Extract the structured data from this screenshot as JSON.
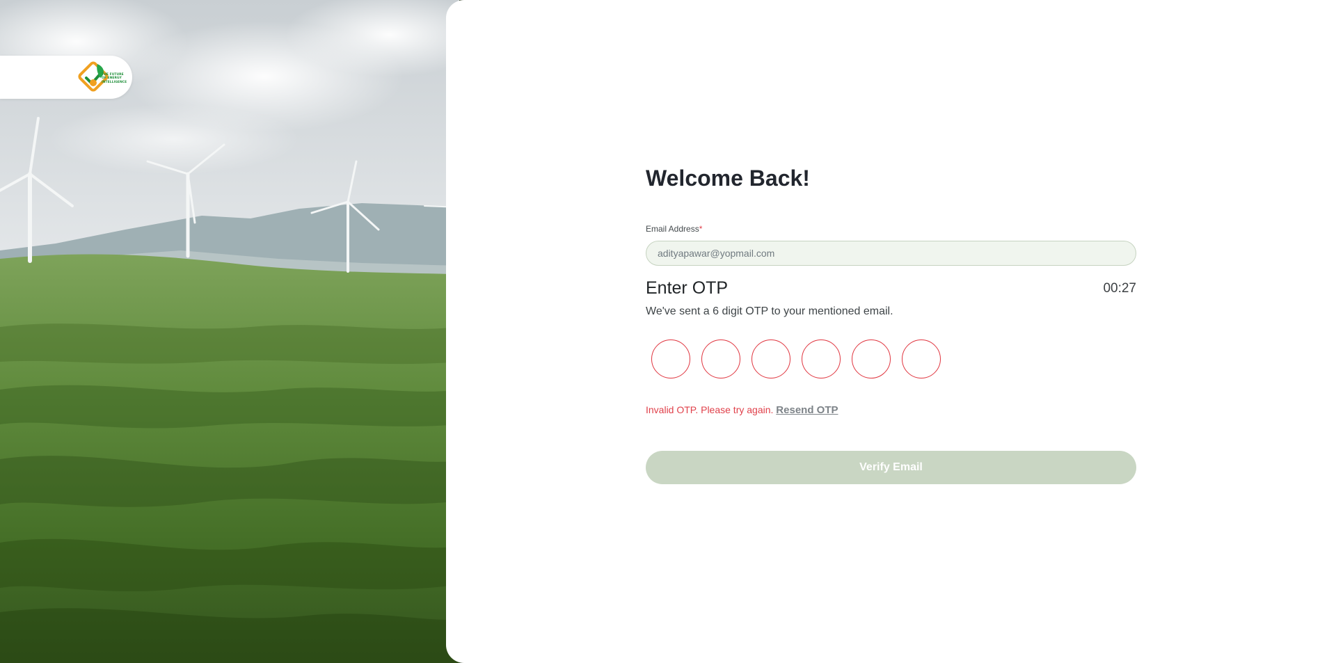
{
  "brand": {
    "logo_name": "leaf-checkmark-logo",
    "logo_lines": [
      "THE FUTURE",
      "OF ENERGY",
      "INTELLIGENCE"
    ]
  },
  "login": {
    "title": "Welcome Back!",
    "email": {
      "label": "Email Address",
      "required_marker": "*",
      "value": "adityapawar@yopmail.com"
    },
    "otp": {
      "title": "Enter OTP",
      "timer": "00:27",
      "description": "We've sent a 6 digit OTP to your mentioned email.",
      "digits": [
        "",
        "",
        "",
        "",
        "",
        ""
      ],
      "error_text": "Invalid OTP. Please try again.",
      "resend_label": "Resend OTP"
    },
    "verify_label": "Verify Email"
  },
  "colors": {
    "accent_green": "#c9d6c3",
    "error_red": "#e0404a",
    "input_background": "#f0f5ee"
  }
}
